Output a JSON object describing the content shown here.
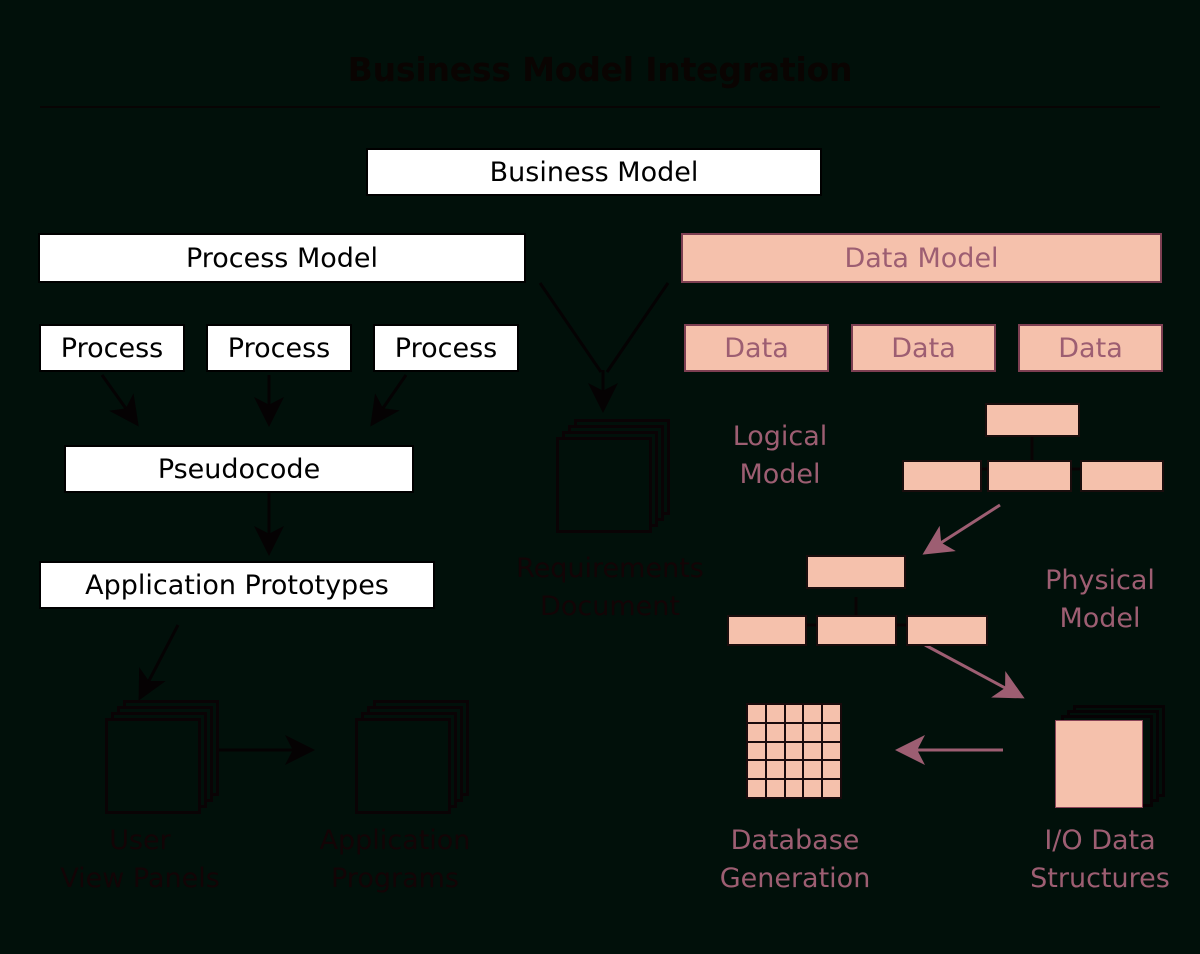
{
  "title": "Business Model Integration",
  "boxes": {
    "business_model": "Business Model",
    "process_model": "Process Model",
    "data_model": "Data Model",
    "process_1": "Process",
    "process_2": "Process",
    "process_3": "Process",
    "data_1": "Data",
    "data_2": "Data",
    "data_3": "Data",
    "pseudocode": "Pseudocode",
    "application_prototypes": "Application Prototypes"
  },
  "captions": {
    "requirements_document_line1": "Requirements",
    "requirements_document_line2": "Document",
    "logical_model_line1": "Logical",
    "logical_model_line2": "Model",
    "physical_model_line1": "Physical",
    "physical_model_line2": "Model",
    "user_view_panels_line1": "User",
    "user_view_panels_line2": "View Panels",
    "application_programs_line1": "Application",
    "application_programs_line2": "Programs",
    "database_generation_line1": "Database",
    "database_generation_line2": "Generation",
    "io_data_structures_line1": "I/O Data",
    "io_data_structures_line2": "Structures"
  },
  "colors": {
    "background": "#01100a",
    "salmon_fill": "#f5c1ac",
    "rose_text": "#9d5e72",
    "rose_arrow": "#9d5e72",
    "white_fill": "#ffffff",
    "dark_stroke": "#000000",
    "dark_text": "#130406"
  },
  "structure": {
    "logical_model_nodes": 4,
    "physical_model_nodes": 4,
    "database_grid_rows": 5,
    "database_grid_cols": 5,
    "document_stack_sheets": 4
  }
}
